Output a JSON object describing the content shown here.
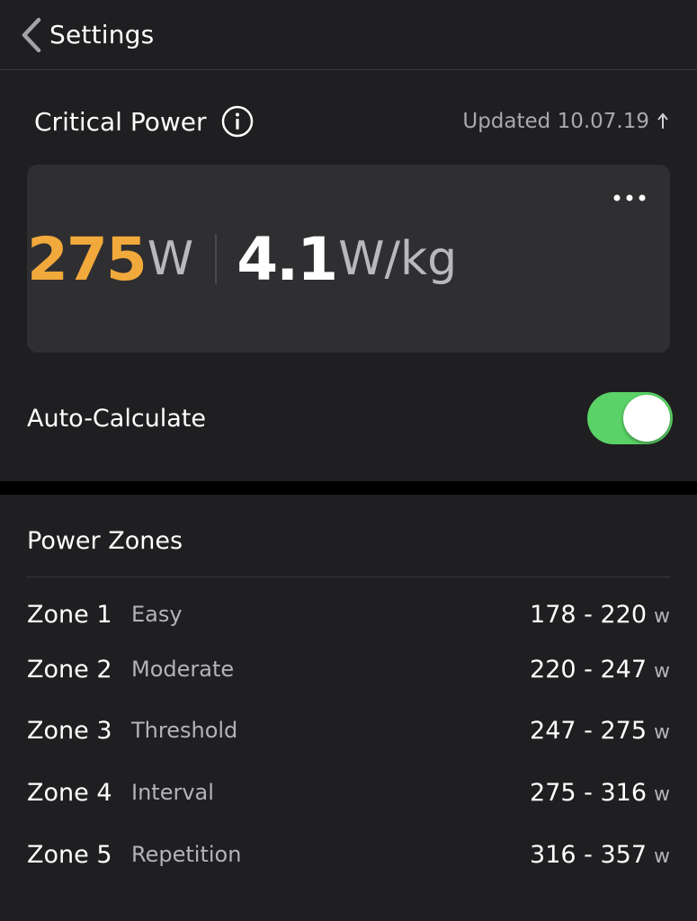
{
  "nav": {
    "back_label": "Settings"
  },
  "critical_power": {
    "title": "Critical Power",
    "updated": "Updated 10.07.19",
    "watts_value": "275",
    "watts_unit": "W",
    "wkg_value": "4.1",
    "wkg_unit": "W/kg"
  },
  "auto_calculate": {
    "label": "Auto-Calculate",
    "enabled": true
  },
  "power_zones": {
    "title": "Power Zones",
    "unit": "w",
    "zones": [
      {
        "name": "Zone 1",
        "desc": "Easy",
        "range": "178 - 220"
      },
      {
        "name": "Zone 2",
        "desc": "Moderate",
        "range": "220 - 247"
      },
      {
        "name": "Zone 3",
        "desc": "Threshold",
        "range": "247 - 275"
      },
      {
        "name": "Zone 4",
        "desc": "Interval",
        "range": "275 - 316"
      },
      {
        "name": "Zone 5",
        "desc": "Repetition",
        "range": "316 - 357"
      }
    ]
  },
  "colors": {
    "background": "#1f1f21",
    "card": "#2f2f31",
    "accent_orange": "#f2a93b",
    "toggle_on": "#5bd267"
  },
  "icons": [
    "chevron-left-icon",
    "info-icon",
    "upload-arrow-icon",
    "more-dots-icon"
  ]
}
